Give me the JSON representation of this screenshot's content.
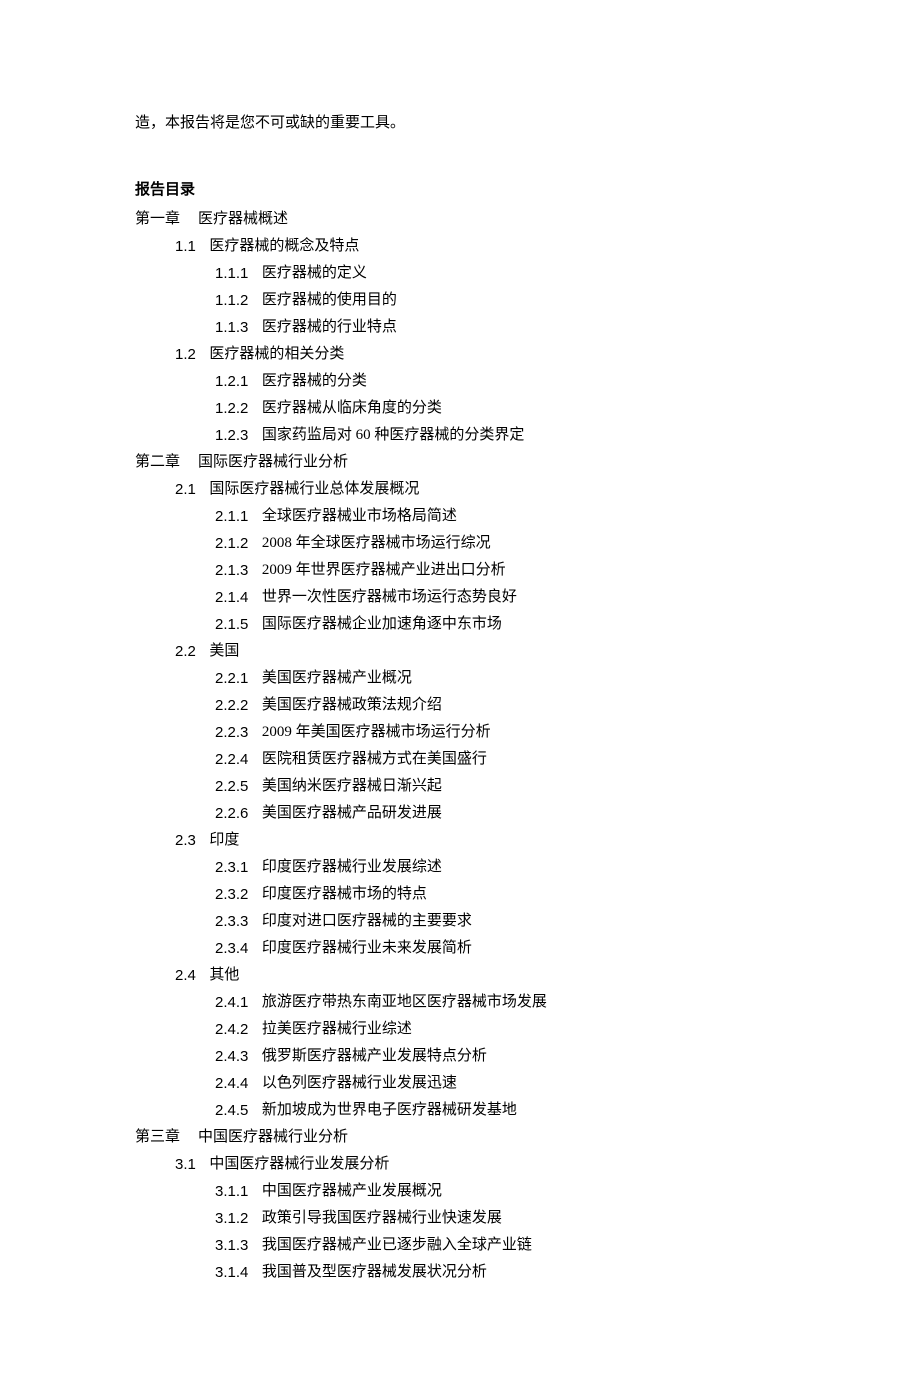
{
  "intro_line": "造，本报告将是您不可或缺的重要工具。",
  "toc_title": "报告目录",
  "chapters": [
    {
      "label": "第一章",
      "title": "医疗器械概述",
      "sections": [
        {
          "num": "1.1",
          "title": "医疗器械的概念及特点",
          "subs": [
            {
              "num": "1.1.1",
              "title": "医疗器械的定义"
            },
            {
              "num": "1.1.2",
              "title": "医疗器械的使用目的"
            },
            {
              "num": "1.1.3",
              "title": "医疗器械的行业特点"
            }
          ]
        },
        {
          "num": "1.2",
          "title": "医疗器械的相关分类",
          "subs": [
            {
              "num": "1.2.1",
              "title": "医疗器械的分类"
            },
            {
              "num": "1.2.2",
              "title": "医疗器械从临床角度的分类"
            },
            {
              "num": "1.2.3",
              "title": "国家药监局对 60 种医疗器械的分类界定"
            }
          ]
        }
      ]
    },
    {
      "label": "第二章",
      "title": "国际医疗器械行业分析",
      "sections": [
        {
          "num": "2.1",
          "title": "国际医疗器械行业总体发展概况",
          "subs": [
            {
              "num": "2.1.1",
              "title": "全球医疗器械业市场格局简述"
            },
            {
              "num": "2.1.2",
              "title": "2008 年全球医疗器械市场运行综况"
            },
            {
              "num": "2.1.3",
              "title": "2009 年世界医疗器械产业进出口分析"
            },
            {
              "num": "2.1.4",
              "title": "世界一次性医疗器械市场运行态势良好"
            },
            {
              "num": "2.1.5",
              "title": "国际医疗器械企业加速角逐中东市场"
            }
          ]
        },
        {
          "num": "2.2",
          "title": "美国",
          "subs": [
            {
              "num": "2.2.1",
              "title": "美国医疗器械产业概况"
            },
            {
              "num": "2.2.2",
              "title": "美国医疗器械政策法规介绍"
            },
            {
              "num": "2.2.3",
              "title": "2009 年美国医疗器械市场运行分析"
            },
            {
              "num": "2.2.4",
              "title": "医院租赁医疗器械方式在美国盛行"
            },
            {
              "num": "2.2.5",
              "title": "美国纳米医疗器械日渐兴起"
            },
            {
              "num": "2.2.6",
              "title": "美国医疗器械产品研发进展"
            }
          ]
        },
        {
          "num": "2.3",
          "title": "印度",
          "subs": [
            {
              "num": "2.3.1",
              "title": "印度医疗器械行业发展综述"
            },
            {
              "num": "2.3.2",
              "title": "印度医疗器械市场的特点"
            },
            {
              "num": "2.3.3",
              "title": "印度对进口医疗器械的主要要求"
            },
            {
              "num": "2.3.4",
              "title": "印度医疗器械行业未来发展简析"
            }
          ]
        },
        {
          "num": "2.4",
          "title": "其他",
          "subs": [
            {
              "num": "2.4.1",
              "title": "旅游医疗带热东南亚地区医疗器械市场发展"
            },
            {
              "num": "2.4.2",
              "title": "拉美医疗器械行业综述"
            },
            {
              "num": "2.4.3",
              "title": "俄罗斯医疗器械产业发展特点分析"
            },
            {
              "num": "2.4.4",
              "title": "以色列医疗器械行业发展迅速"
            },
            {
              "num": "2.4.5",
              "title": "新加坡成为世界电子医疗器械研发基地"
            }
          ]
        }
      ]
    },
    {
      "label": "第三章",
      "title": "中国医疗器械行业分析",
      "sections": [
        {
          "num": "3.1",
          "title": "中国医疗器械行业发展分析",
          "subs": [
            {
              "num": "3.1.1",
              "title": "中国医疗器械产业发展概况"
            },
            {
              "num": "3.1.2",
              "title": "政策引导我国医疗器械行业快速发展"
            },
            {
              "num": "3.1.3",
              "title": "我国医疗器械产业已逐步融入全球产业链"
            },
            {
              "num": "3.1.4",
              "title": "我国普及型医疗器械发展状况分析"
            }
          ]
        }
      ]
    }
  ]
}
